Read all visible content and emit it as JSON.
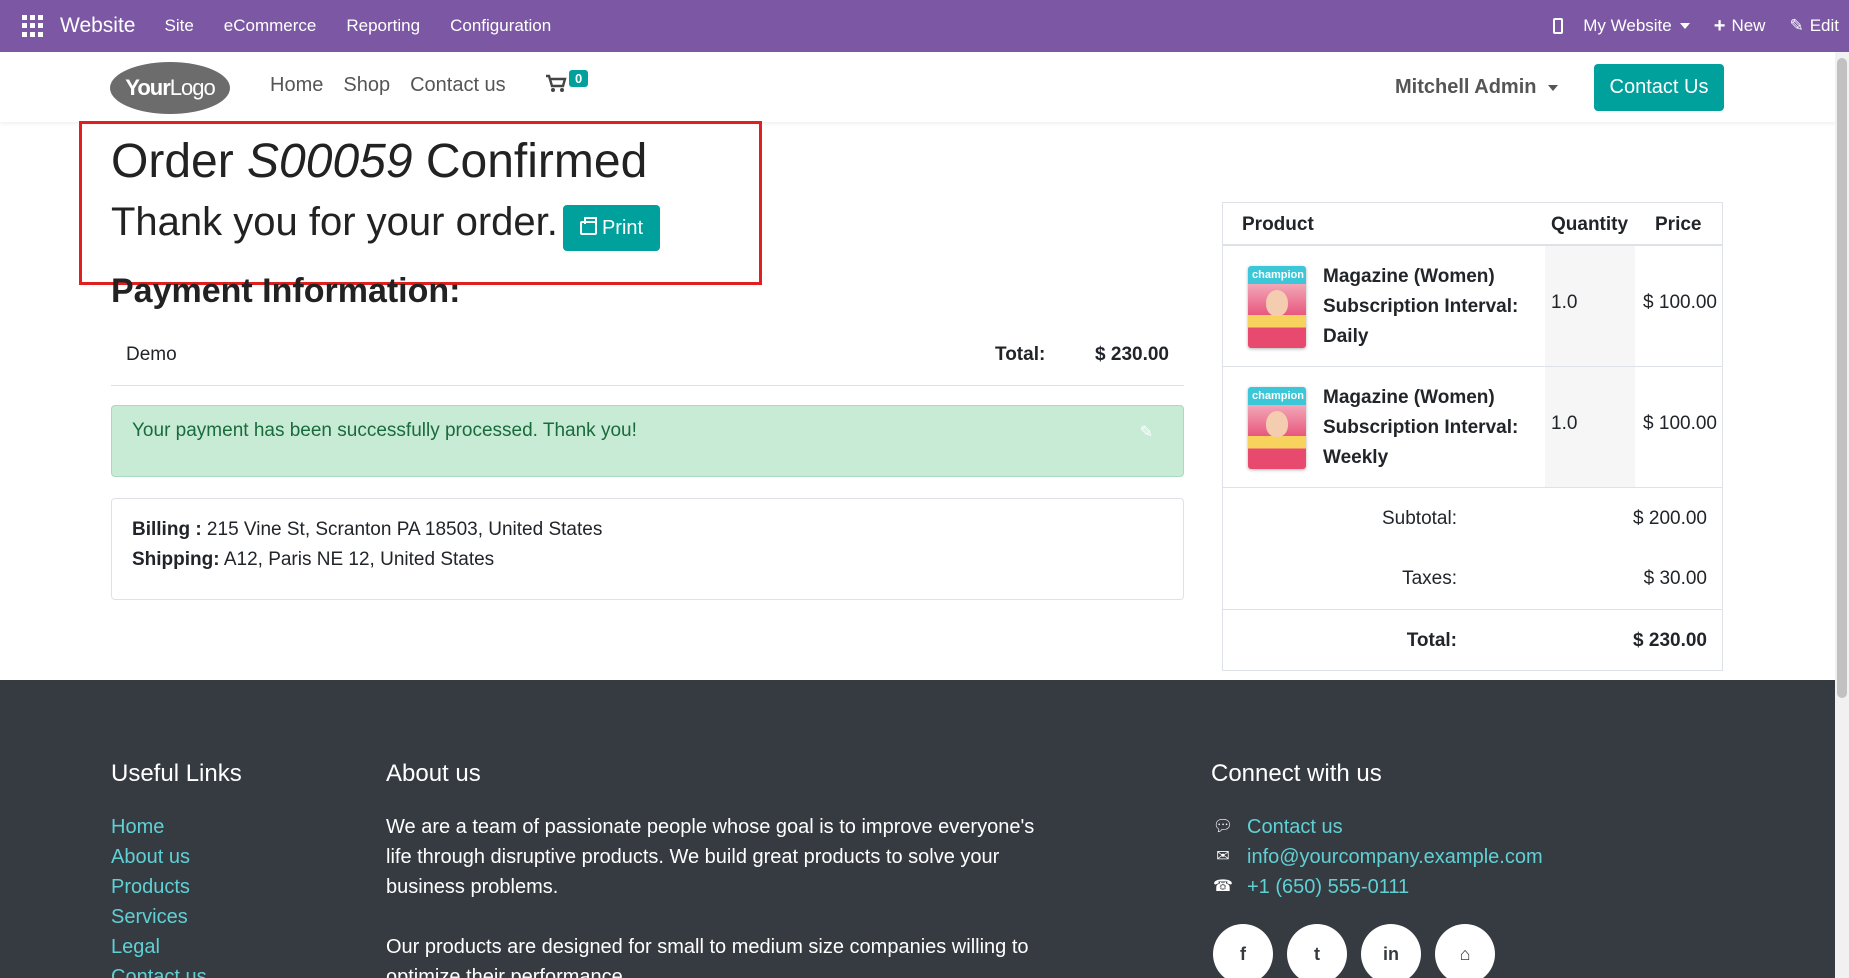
{
  "adminbar": {
    "brand": "Website",
    "menu": [
      "Site",
      "eCommerce",
      "Reporting",
      "Configuration"
    ],
    "website_selector": "My Website",
    "new_label": "New",
    "edit_label": "Edit"
  },
  "header": {
    "logo_bold": "Your",
    "logo_light": "Logo",
    "nav": [
      "Home",
      "Shop",
      "Contact us"
    ],
    "cart_count": "0",
    "user": "Mitchell Admin",
    "contact_button": "Contact Us"
  },
  "order": {
    "title_prefix": "Order ",
    "order_number": "S00059",
    "title_suffix": " Confirmed",
    "thanks": "Thank you for your order.",
    "print_label": "Print"
  },
  "payment": {
    "heading": "Payment Information:",
    "method": "Demo",
    "total_label": "Total:",
    "total_value": "$ 230.00",
    "alert": "Your payment has been successfully processed. Thank you!"
  },
  "address": {
    "billing_label": "Billing :",
    "billing_value": " 215 Vine St, Scranton PA 18503, United States",
    "shipping_label": "Shipping:",
    "shipping_value": " A12, Paris NE 12, United States"
  },
  "summary": {
    "headers": [
      "Product",
      "Quantity",
      "Price"
    ],
    "rows": [
      {
        "name": "Magazine (Women) Subscription Interval: Daily",
        "qty": "1.0",
        "price": "$ 100.00",
        "thumb_text": "champion"
      },
      {
        "name": "Magazine (Women) Subscription Interval: Weekly",
        "qty": "1.0",
        "price": "$ 100.00",
        "thumb_text": "champion"
      }
    ],
    "subtotal_label": "Subtotal:",
    "subtotal_value": "$ 200.00",
    "taxes_label": "Taxes:",
    "taxes_value": "$ 30.00",
    "total_label": "Total:",
    "total_value": "$ 230.00"
  },
  "footer": {
    "useful_links_title": "Useful Links",
    "useful_links": [
      "Home",
      "About us",
      "Products",
      "Services",
      "Legal",
      "Contact us"
    ],
    "about_title": "About us",
    "about_p1": "We are a team of passionate people whose goal is to improve everyone's life through disruptive products. We build great products to solve your business problems.",
    "about_p2": "Our products are designed for small to medium size companies willing to optimize their performance.",
    "connect_title": "Connect with us",
    "contact_link": "Contact us",
    "email": "info@yourcompany.example.com",
    "phone": "+1 (650) 555-0111",
    "social": [
      "f",
      "t",
      "in",
      "⌂"
    ]
  },
  "colors": {
    "admin_bar": "#7c58a4",
    "primary": "#00a09d",
    "footer_bg": "#363b42",
    "link": "#5fd1d4",
    "highlight_border": "#e01f1f"
  }
}
